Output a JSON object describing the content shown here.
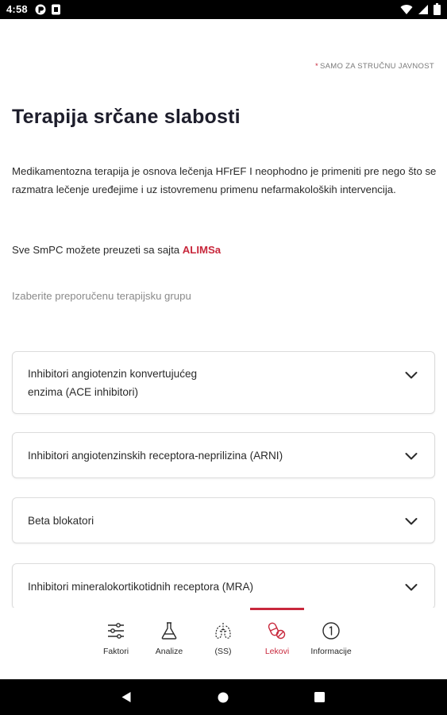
{
  "status_bar": {
    "time": "4:58"
  },
  "badge": {
    "asterisk": "*",
    "text": "SAMO ZA STRUČNU JAVNOST"
  },
  "page": {
    "title": "Terapija srčane slabosti",
    "intro": "Medikamentozna terapija je osnova lečenja HFrEF I neophodno je primeniti pre nego što se razmatra lečenje uređejime i uz istovremenu primenu nefarmakoloških intervencija.",
    "smpc_prefix": "Sve SmPC možete preuzeti sa sajta ",
    "smpc_link": "ALIMSa",
    "choose_label": "Izaberite preporučenu terapijsku grupu"
  },
  "accordions": [
    {
      "line1": "Inhibitori angiotenzin konvertujućeg",
      "line2": "enzima (ACE inhibitori)"
    },
    {
      "line1": "Inhibitori angiotenzinskih receptora-neprilizina (ARNI)"
    },
    {
      "line1": "Beta blokatori"
    },
    {
      "line1": "Inhibitori mineralokortikotidnih receptora (MRA)"
    }
  ],
  "bottom_nav": {
    "items": [
      {
        "label": "Faktori",
        "icon": "sliders-icon"
      },
      {
        "label": "Analize",
        "icon": "flask-icon"
      },
      {
        "label": "(SS)",
        "icon": "lungs-icon"
      },
      {
        "label": "Lekovi",
        "icon": "pills-icon",
        "active": true
      },
      {
        "label": "Informacije",
        "icon": "info-icon"
      }
    ]
  },
  "colors": {
    "accent": "#c8283c",
    "text": "#2a2a2a",
    "muted": "#8a8a8a",
    "border": "#dcdcdc"
  }
}
